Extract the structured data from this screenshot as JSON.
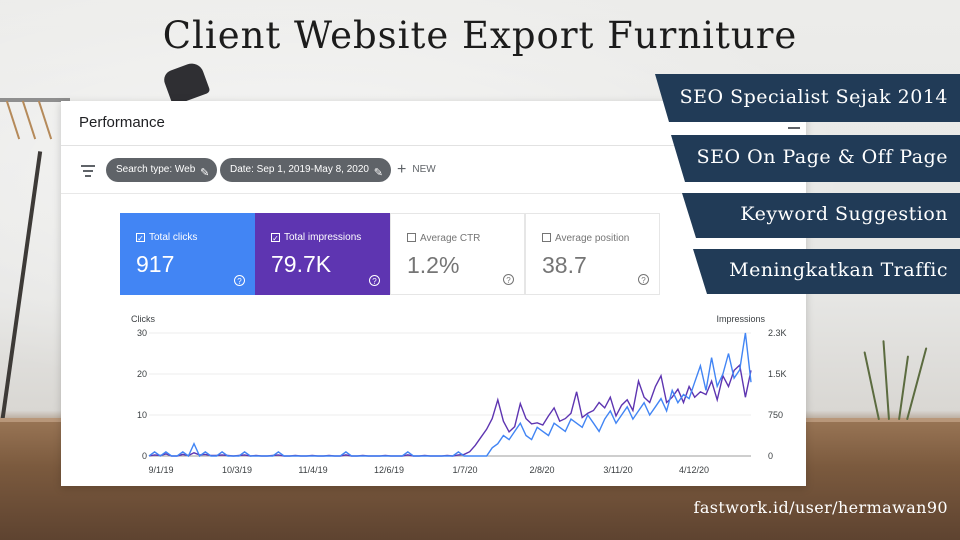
{
  "title": "Client Website Export Furniture",
  "panel": {
    "title": "Performance",
    "filters": [
      "Search type: Web",
      "Date: Sep 1, 2019-May 8, 2020"
    ],
    "new_label": "NEW"
  },
  "metrics": [
    {
      "label": "Total clicks",
      "value": "917",
      "selected": true,
      "color": "#4285f4"
    },
    {
      "label": "Total impressions",
      "value": "79.7K",
      "selected": true,
      "color": "#5e35b1"
    },
    {
      "label": "Average CTR",
      "value": "1.2%",
      "selected": false
    },
    {
      "label": "Average position",
      "value": "38.7",
      "selected": false
    }
  ],
  "chart": {
    "left_axis_label": "Clicks",
    "right_axis_label": "Impressions",
    "left_ticks": [
      "30",
      "20",
      "10",
      "0"
    ],
    "right_ticks": [
      "2.3K",
      "1.5K",
      "750",
      "0"
    ],
    "x_ticks": [
      "9/1/19",
      "10/3/19",
      "11/4/19",
      "12/6/19",
      "1/7/20",
      "2/8/20",
      "3/11/20",
      "4/12/20"
    ]
  },
  "chart_data": {
    "type": "line",
    "x_range": [
      "2019-09-01",
      "2020-05-08"
    ],
    "ylim_left": [
      0,
      30
    ],
    "ylim_right": [
      0,
      2300
    ],
    "grid": true,
    "series": [
      {
        "name": "Clicks",
        "color": "#4285f4",
        "axis": "left",
        "values": [
          0,
          1,
          0,
          1,
          0,
          0,
          1,
          0,
          3,
          0,
          1,
          0,
          0,
          1,
          0,
          0,
          0,
          1,
          0,
          0,
          0,
          0,
          0,
          1,
          0,
          0,
          0,
          0,
          0,
          0,
          0,
          0,
          0,
          0,
          0,
          1,
          0,
          0,
          0,
          0,
          0,
          0,
          0,
          0,
          0,
          0,
          1,
          0,
          0,
          0,
          0,
          0,
          0,
          0,
          0,
          1,
          0,
          0,
          0,
          0,
          0,
          2,
          3,
          5,
          4,
          6,
          8,
          5,
          4,
          7,
          6,
          5,
          8,
          7,
          6,
          9,
          8,
          7,
          10,
          8,
          6,
          9,
          11,
          8,
          10,
          12,
          9,
          11,
          13,
          10,
          12,
          14,
          11,
          16,
          13,
          15,
          14,
          18,
          22,
          16,
          24,
          17,
          20,
          25,
          19,
          21,
          30,
          18
        ]
      },
      {
        "name": "Impressions",
        "color": "#5e35b1",
        "axis": "right",
        "values": [
          0,
          20,
          10,
          40,
          0,
          0,
          30,
          10,
          60,
          20,
          30,
          10,
          10,
          20,
          10,
          0,
          10,
          20,
          0,
          10,
          0,
          0,
          10,
          20,
          0,
          0,
          10,
          0,
          0,
          10,
          0,
          0,
          10,
          0,
          0,
          20,
          0,
          0,
          10,
          0,
          0,
          0,
          10,
          0,
          0,
          0,
          20,
          0,
          0,
          10,
          0,
          0,
          0,
          10,
          0,
          20,
          30,
          80,
          200,
          350,
          500,
          700,
          1050,
          650,
          450,
          550,
          980,
          700,
          600,
          620,
          580,
          750,
          900,
          650,
          700,
          800,
          1200,
          720,
          800,
          850,
          1000,
          900,
          1100,
          750,
          950,
          1050,
          850,
          1400,
          1100,
          1000,
          1300,
          1500,
          1000,
          1100,
          1250,
          1000,
          1300,
          1100,
          1200,
          1150,
          1400,
          1050,
          1500,
          1300,
          1600,
          1700,
          1100,
          1600
        ]
      }
    ]
  },
  "ribbons": [
    "SEO Specialist Sejak 2014",
    "SEO On Page & Off Page",
    "Keyword Suggestion",
    "Meningkatkan Traffic"
  ],
  "footer_url": "fastwork.id/user/hermawan90"
}
